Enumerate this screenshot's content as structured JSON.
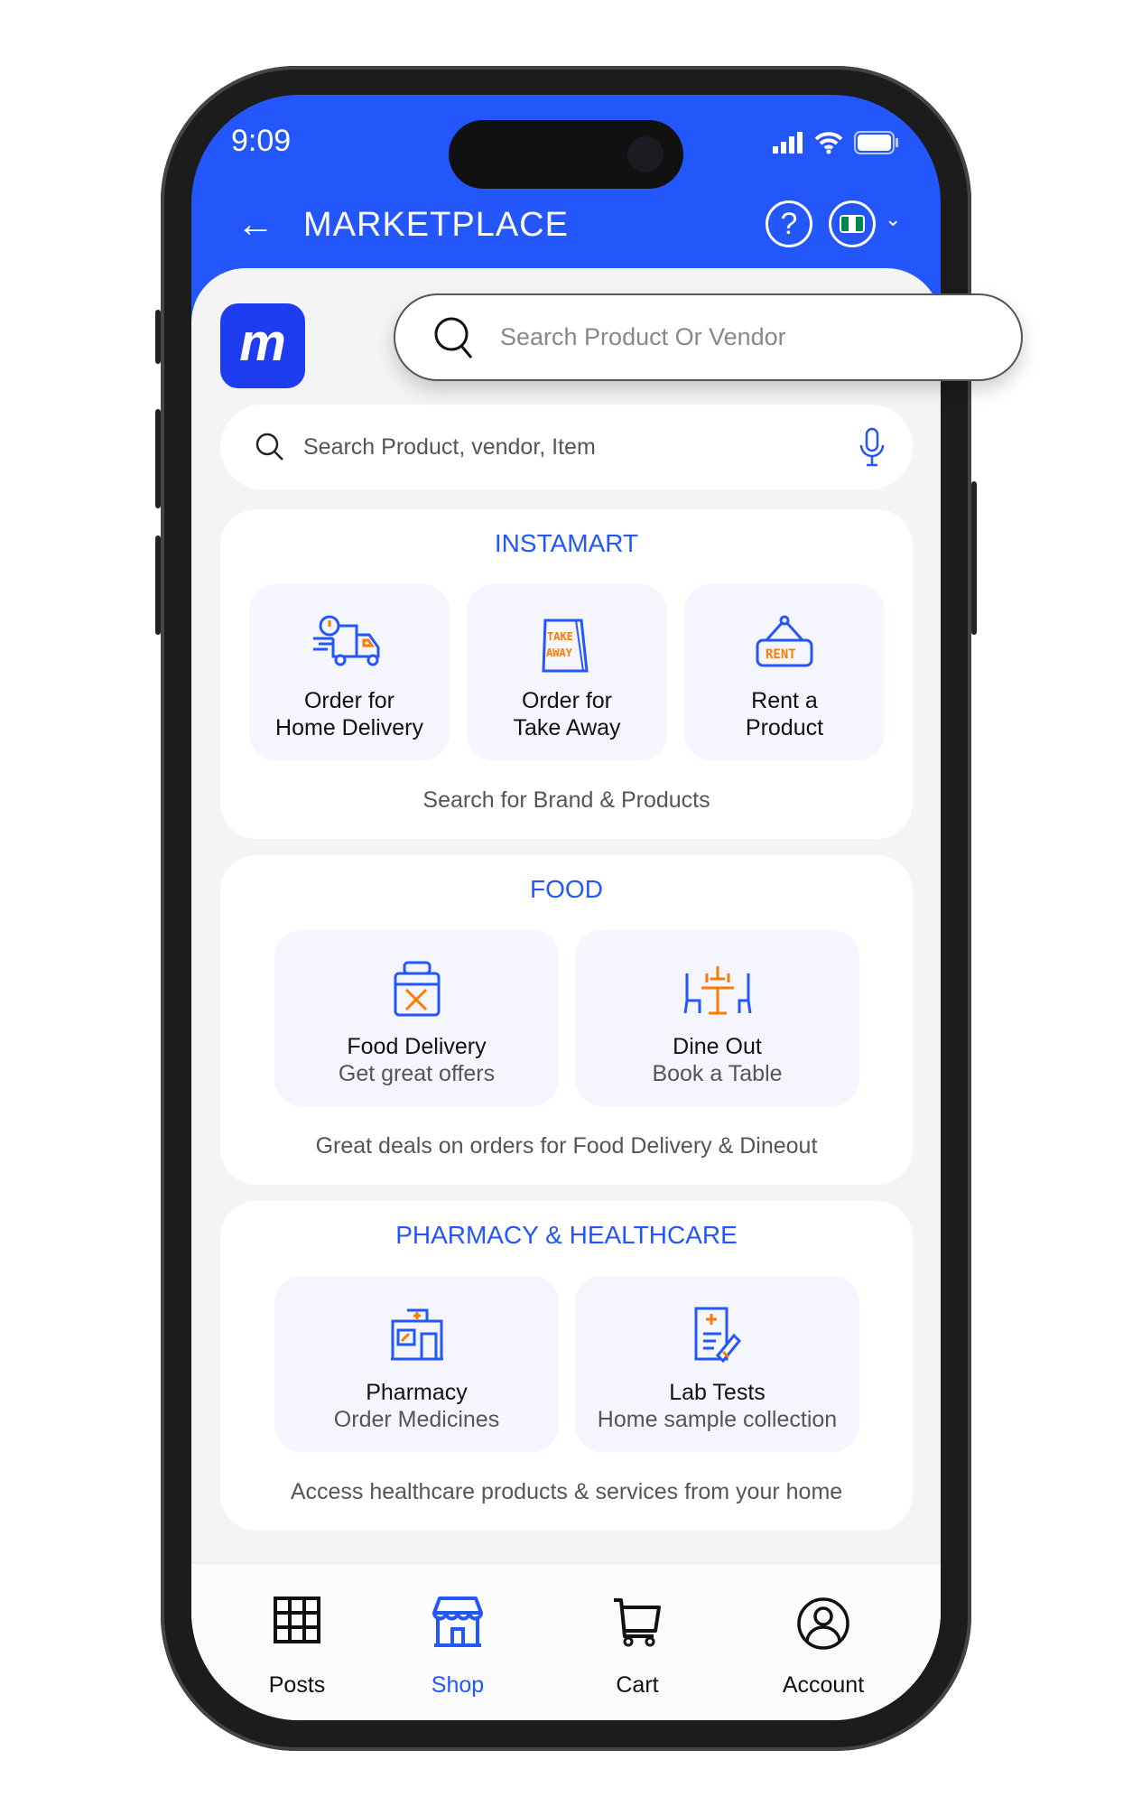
{
  "status": {
    "time": "9:09"
  },
  "header": {
    "title": "MARKETPLACE",
    "help": "?"
  },
  "logo": {
    "letter": "m"
  },
  "floating_search": {
    "placeholder": "Search Product Or Vendor"
  },
  "search": {
    "placeholder": "Search Product, vendor, Item"
  },
  "instamart": {
    "title": "INSTAMART",
    "tiles": [
      {
        "l1": "Order for",
        "l2": "Home Delivery"
      },
      {
        "l1": "Order for",
        "l2": "Take Away"
      },
      {
        "l1": "Rent a",
        "l2": "Product"
      }
    ],
    "footer": "Search for Brand & Products",
    "icon_text": {
      "take": "TAKE",
      "away": "AWAY",
      "rent": "RENT"
    }
  },
  "food": {
    "title": "FOOD",
    "tiles": [
      {
        "l1": "Food Delivery",
        "l2": "Get great offers"
      },
      {
        "l1": "Dine Out",
        "l2": "Book a Table"
      }
    ],
    "footer": "Great deals on orders for Food Delivery & Dineout"
  },
  "pharmacy": {
    "title": "PHARMACY & HEALTHCARE",
    "tiles": [
      {
        "l1": "Pharmacy",
        "l2": "Order Medicines"
      },
      {
        "l1": "Lab Tests",
        "l2": "Home sample collection"
      }
    ],
    "footer": "Access healthcare products & services from your home"
  },
  "nav": [
    {
      "label": "Posts"
    },
    {
      "label": "Shop"
    },
    {
      "label": "Cart"
    },
    {
      "label": "Account"
    }
  ],
  "colors": {
    "brand": "#2457fb",
    "accent": "#ff7a00"
  }
}
